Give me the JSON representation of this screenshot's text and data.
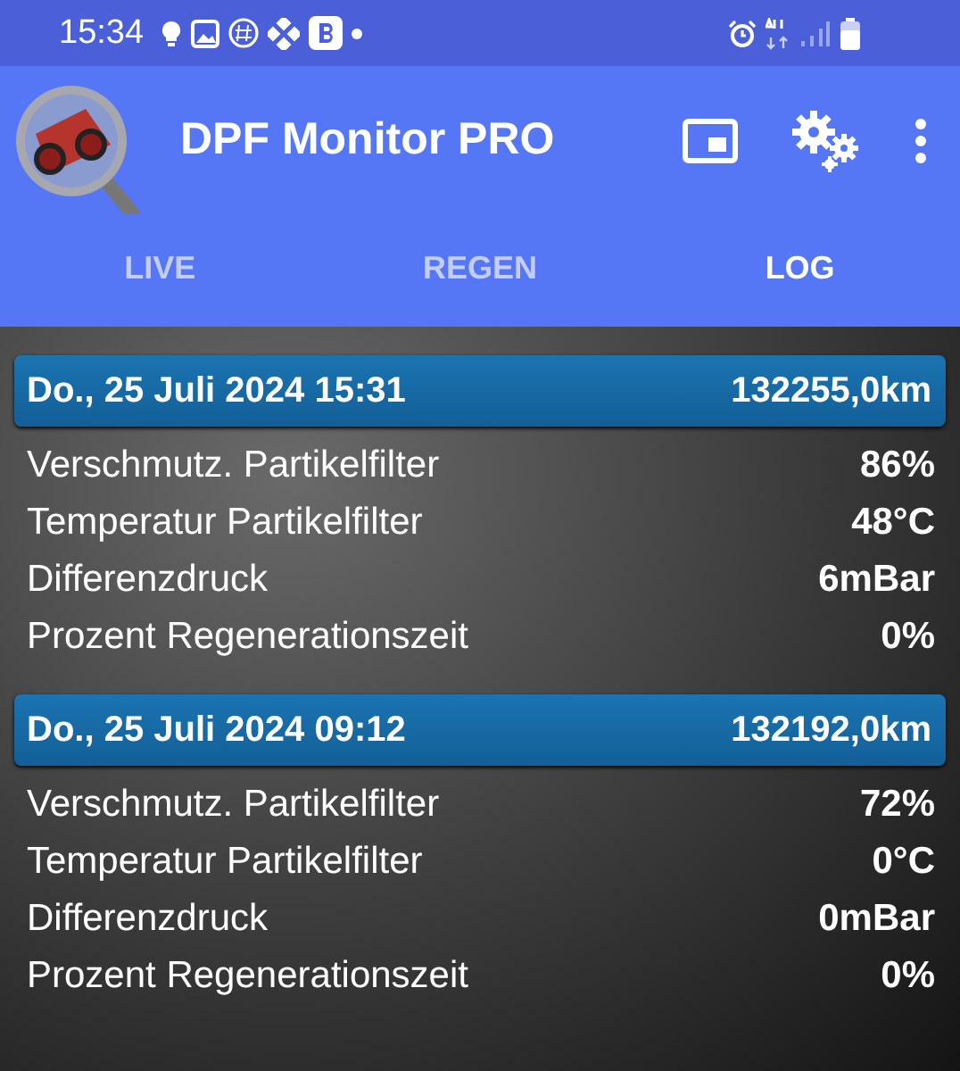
{
  "status_bar": {
    "time": "15:34"
  },
  "app_bar": {
    "title": "DPF Monitor PRO"
  },
  "tabs": [
    {
      "label": "LIVE",
      "selected": false
    },
    {
      "label": "REGEN",
      "selected": false
    },
    {
      "label": "LOG",
      "selected": true
    }
  ],
  "log_entries": [
    {
      "date": "Do., 25 Juli 2024 15:31",
      "odometer": "132255,0km",
      "rows": [
        {
          "label": "Verschmutz. Partikelfilter",
          "value": "86%"
        },
        {
          "label": "Temperatur Partikelfilter",
          "value": "48°C"
        },
        {
          "label": "Differenzdruck",
          "value": "6mBar"
        },
        {
          "label": "Prozent Regenerationszeit",
          "value": "0%"
        }
      ]
    },
    {
      "date": "Do., 25 Juli 2024 09:12",
      "odometer": "132192,0km",
      "rows": [
        {
          "label": "Verschmutz. Partikelfilter",
          "value": "72%"
        },
        {
          "label": "Temperatur Partikelfilter",
          "value": "0°C"
        },
        {
          "label": "Differenzdruck",
          "value": "0mBar"
        },
        {
          "label": "Prozent Regenerationszeit",
          "value": "0%"
        }
      ]
    }
  ]
}
